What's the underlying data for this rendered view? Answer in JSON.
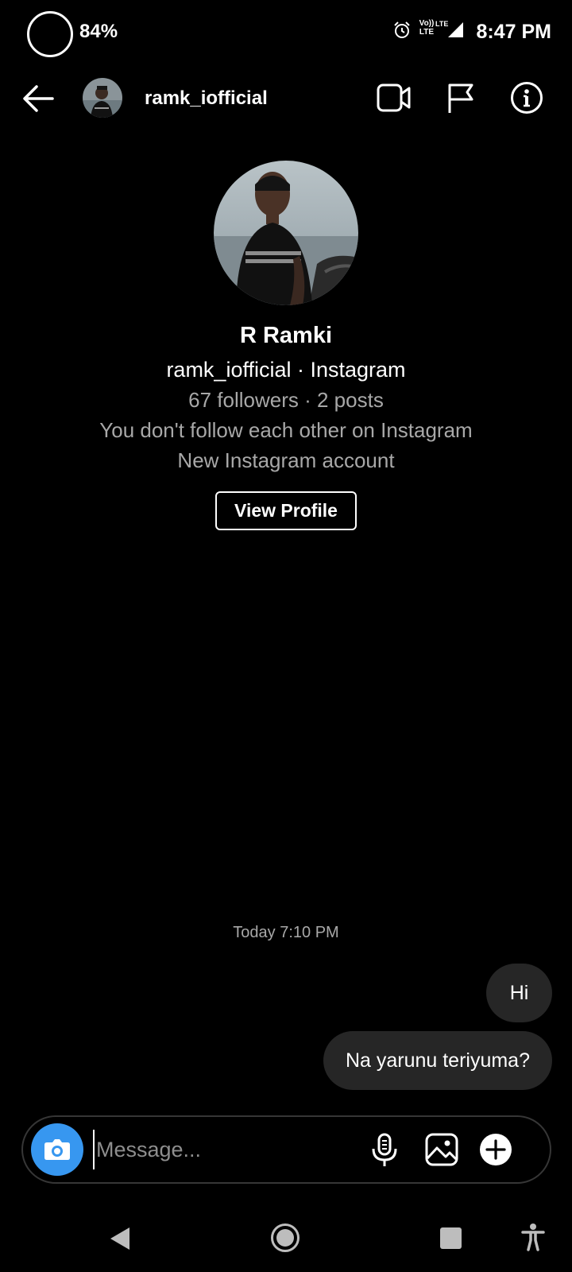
{
  "status_bar": {
    "battery": "84%",
    "volte_label": "Vo)) LTE",
    "lte_label": "LTE",
    "time": "8:47 PM"
  },
  "header": {
    "username": "ramk_iofficial",
    "icons": [
      "back-arrow-icon",
      "video-call-icon",
      "flag-icon",
      "info-icon"
    ]
  },
  "profile": {
    "name": "R Ramki",
    "handle_line": "ramk_iofficial · Instagram",
    "stats_line": "67 followers · 2 posts",
    "follow_line": "You don't follow each other on Instagram",
    "account_line": "New Instagram account",
    "view_profile_label": "View Profile"
  },
  "thread": {
    "timestamp": "Today 7:10 PM",
    "messages": [
      {
        "text": "Hi",
        "sender": "me"
      },
      {
        "text": "Na yarunu teriyuma?",
        "sender": "me"
      }
    ]
  },
  "composer": {
    "placeholder": "Message...",
    "value": "",
    "accent_color": "#3797f0"
  },
  "colors": {
    "background": "#000000",
    "bubble": "#262626",
    "secondary_text": "#a8a8a8"
  }
}
